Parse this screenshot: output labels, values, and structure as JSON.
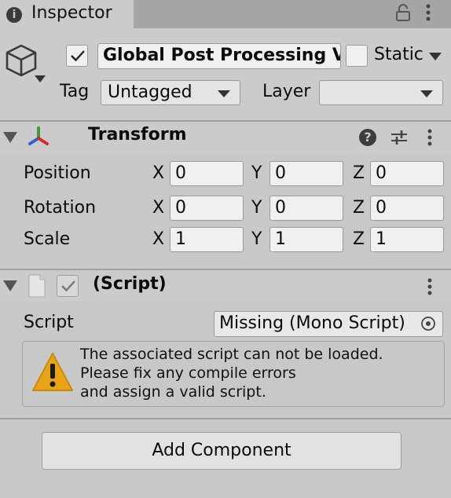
{
  "tab": {
    "title": "Inspector",
    "info_glyph": "i"
  },
  "object": {
    "active": true,
    "name": "Global Post Processing Volume",
    "static_label": "Static",
    "static": false,
    "tag_label": "Tag",
    "tag_value": "Untagged",
    "layer_label": "Layer",
    "layer_value": ""
  },
  "transform": {
    "title": "Transform",
    "help_glyph": "?",
    "rows": [
      {
        "label": "Position",
        "x": "0",
        "y": "0",
        "z": "0"
      },
      {
        "label": "Rotation",
        "x": "0",
        "y": "0",
        "z": "0"
      },
      {
        "label": "Scale",
        "x": "1",
        "y": "1",
        "z": "1"
      }
    ],
    "axis_labels": {
      "x": "X",
      "y": "Y",
      "z": "Z"
    }
  },
  "script_component": {
    "title": "(Script)",
    "enabled": true,
    "field_label": "Script",
    "field_value": "Missing (Mono Script)",
    "warning_lines": [
      "The associated script can not be loaded.",
      "Please fix any compile errors",
      "and assign a valid script."
    ]
  },
  "add_component_label": "Add Component",
  "colors": {
    "panel": "#c8c8c8",
    "tabbar": "#a5a5a5",
    "warning": "#e8a317",
    "axis_x": "#d62a2a",
    "axis_y": "#3e9a3a",
    "axis_z": "#2f5fd0"
  },
  "icons": [
    "lock-icon",
    "kebab-menu-icon",
    "gameobject-cube-icon",
    "transform-axes-icon",
    "help-icon",
    "preset-sliders-icon",
    "file-icon",
    "object-picker-icon",
    "warning-icon"
  ]
}
